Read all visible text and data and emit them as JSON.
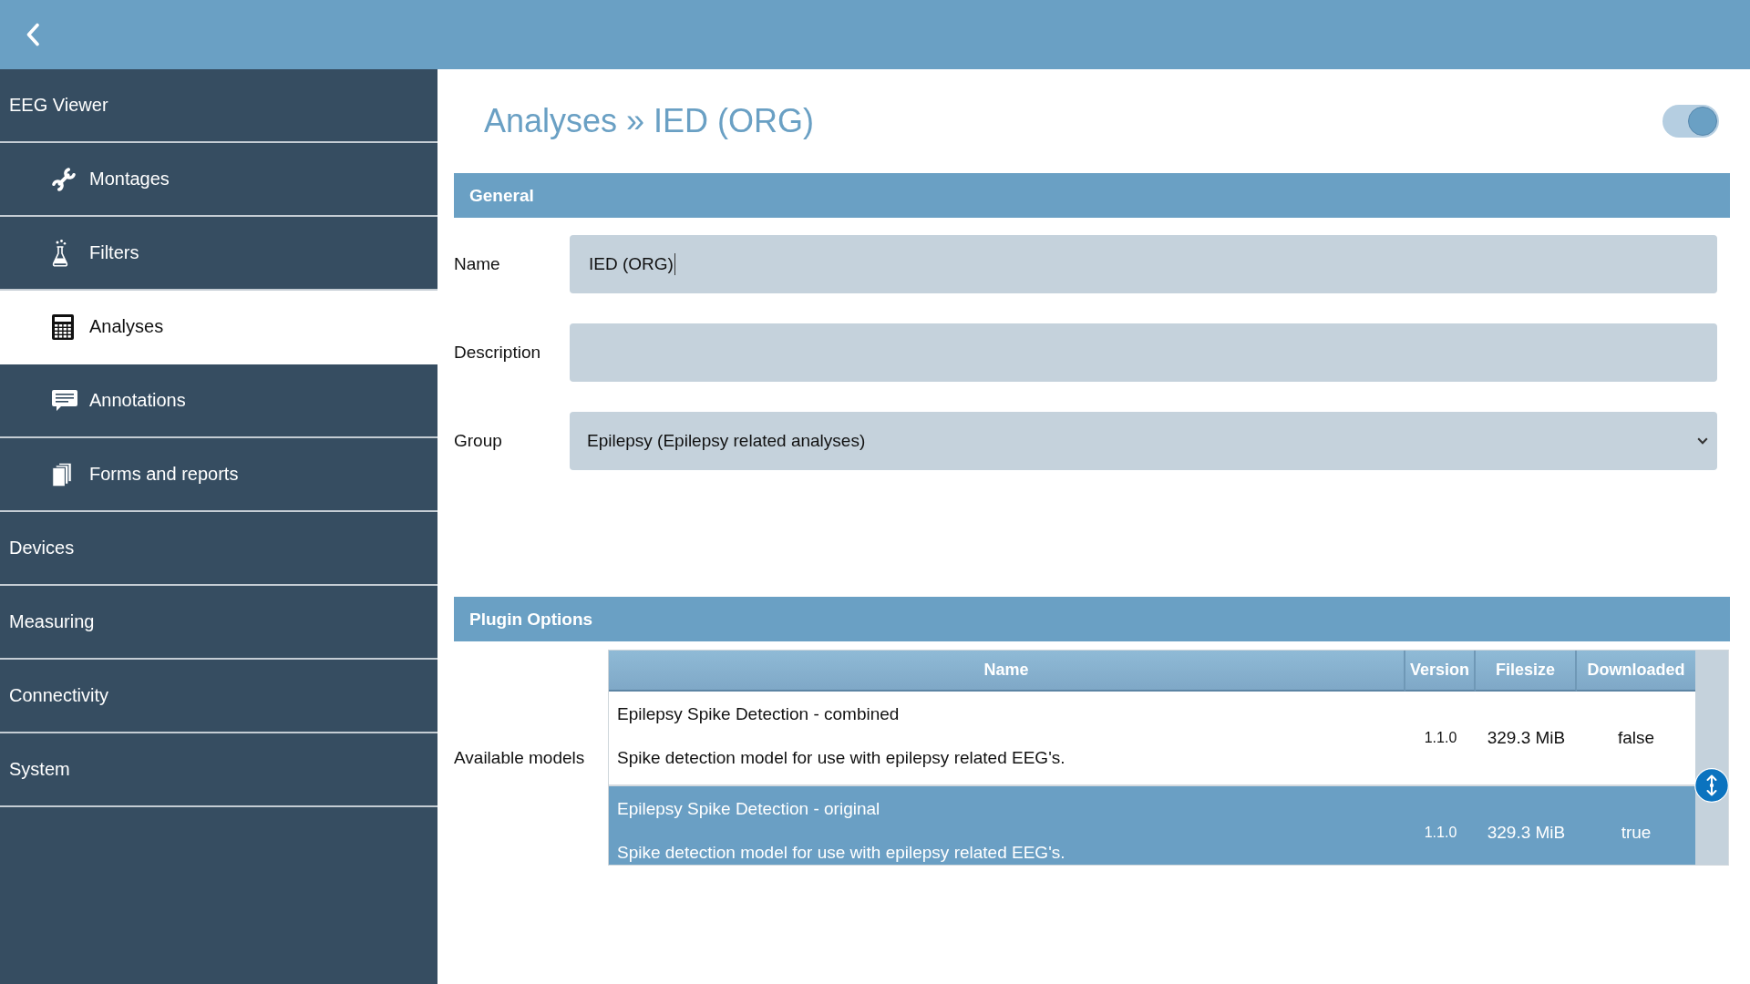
{
  "sidebar": {
    "items": [
      {
        "label": "EEG Viewer",
        "selected": false,
        "children": [
          {
            "label": "Montages",
            "selected": false
          },
          {
            "label": "Filters",
            "selected": false
          },
          {
            "label": "Analyses",
            "selected": true
          },
          {
            "label": "Annotations",
            "selected": false
          },
          {
            "label": "Forms and reports",
            "selected": false
          }
        ]
      },
      {
        "label": "Devices",
        "selected": false
      },
      {
        "label": "Measuring",
        "selected": false
      },
      {
        "label": "Connectivity",
        "selected": false
      },
      {
        "label": "System",
        "selected": false
      }
    ]
  },
  "page": {
    "title": "Analyses » IED (ORG)",
    "toggle": {
      "on": true
    }
  },
  "general": {
    "heading": "General",
    "fields": [
      {
        "label": "Name",
        "kind": "text",
        "value": "IED (ORG)",
        "focused": true
      },
      {
        "label": "Description",
        "kind": "text",
        "focused": false
      },
      {
        "label": "Group",
        "kind": "select",
        "value": "Epilepsy (Epilepsy related analyses)",
        "focused": false
      }
    ]
  },
  "plugin_options": {
    "heading": "Plugin Options",
    "label": "Available models",
    "table": {
      "columns": [
        "Name",
        "Version",
        "Filesize",
        "Downloaded"
      ],
      "rows": [
        {
          "name": "Epilepsy Spike Detection - combined",
          "description": "Spike detection model for use with epilepsy related EEG's.",
          "version": "1.1.0",
          "filesize": "329.3 MiB",
          "downloaded": "false",
          "selected": false
        },
        {
          "name": "Epilepsy Spike Detection - original",
          "description": "Spike detection model for use with epilepsy related EEG's.",
          "version": "1.1.0",
          "filesize": "329.3 MiB",
          "downloaded": "true",
          "selected": true
        }
      ]
    }
  }
}
